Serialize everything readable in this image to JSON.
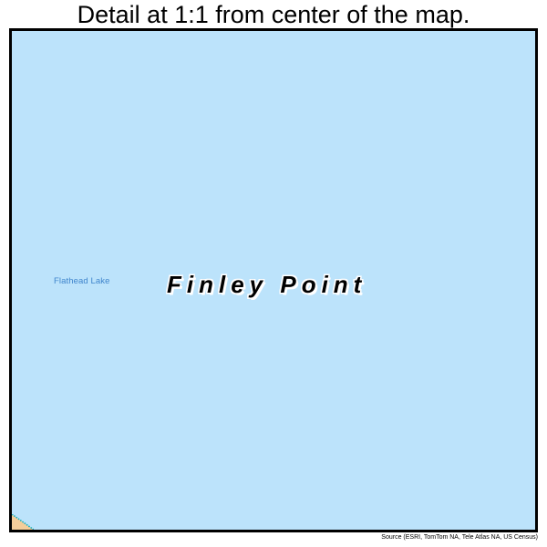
{
  "title": "Detail at 1:1 from center of the map.",
  "map": {
    "water_label": "Flathead Lake",
    "place_label": "Finley Point",
    "colors": {
      "water": "#bce3fb",
      "land": "#f4cd9a",
      "shoreline": "#17b3c4",
      "water_label_text": "#3f85cc",
      "place_label_text": "#000000",
      "place_label_halo": "#ffffff",
      "frame_border": "#000000",
      "page_background": "#ffffff"
    }
  },
  "source_credit": "Source (ESRI, TomTom NA, Tele Atlas NA, US Census)"
}
